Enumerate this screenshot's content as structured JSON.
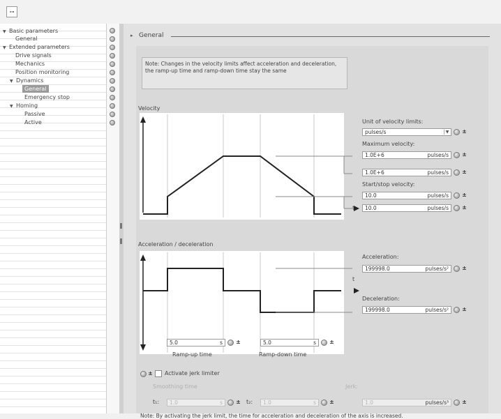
{
  "toolbar": {
    "icon": "network-icon",
    "symbol": "⊶"
  },
  "nav": {
    "items": [
      {
        "label": "Basic parameters",
        "level": 0,
        "expanded": true
      },
      {
        "label": "General",
        "level": 1
      },
      {
        "label": "Extended parameters",
        "level": 0,
        "expanded": true
      },
      {
        "label": "Drive signals",
        "level": 1
      },
      {
        "label": "Mechanics",
        "level": 1
      },
      {
        "label": "Position monitoring",
        "level": 1
      },
      {
        "label": "Dynamics",
        "level": 1,
        "expanded": true
      },
      {
        "label": "General",
        "level": 2,
        "selected": true
      },
      {
        "label": "Emergency stop",
        "level": 2
      },
      {
        "label": "Homing",
        "level": 1,
        "expanded": true
      },
      {
        "label": "Passive",
        "level": 2
      },
      {
        "label": "Active",
        "level": 2
      }
    ]
  },
  "section": {
    "title": "General"
  },
  "note_top": "Note: Changes in the velocity limits affect acceleration and deceleration, the ramp-up time and ramp-down time stay the same",
  "velocity": {
    "graph_label": "Velocity",
    "axis_t": "t",
    "unit_label": "Unit of velocity limits:",
    "unit_value": "pulses/s",
    "max_label": "Maximum velocity:",
    "max_values": [
      {
        "value": "1.0E+6",
        "unit": "pulses/s"
      },
      {
        "value": "1.0E+6",
        "unit": "pulses/s"
      }
    ],
    "startstop_label": "Start/stop velocity:",
    "startstop_values": [
      {
        "value": "10.0",
        "unit": "pulses/s"
      },
      {
        "value": "10.0",
        "unit": "pulses/s"
      }
    ]
  },
  "accel": {
    "graph_label": "Acceleration / deceleration",
    "axis_t": "t",
    "acc_label": "Acceleration:",
    "acc_value": "199998.0",
    "acc_unit": "pulses/s²",
    "dec_label": "Deceleration:",
    "dec_value": "199998.0",
    "dec_unit": "pulses/s²"
  },
  "ramp": {
    "up_value": "5.0",
    "up_unit": "s",
    "up_label": "Ramp-up time",
    "down_value": "5.0",
    "down_unit": "s",
    "down_label": "Ramp-down time"
  },
  "jerk": {
    "checkbox_label": "Activate jerk limiter",
    "checked": false,
    "smoothing_label": "Smoothing time",
    "t1_label": "t₁:",
    "t1_value": "1.0",
    "t1_unit": "s",
    "t2_label": "t₂:",
    "t2_value": "1.0",
    "t2_unit": "s",
    "jerk_label": "Jerk:",
    "jerk_value": "1.0",
    "jerk_unit": "pulses/s³"
  },
  "note_bottom": "Note: By activating the jerk limit, the time for acceleration and deceleration of the axis is increased.",
  "colors": {
    "panel": "#d9d9d9",
    "graph_line": "#222222",
    "selected_nav": "#9a9a9a"
  }
}
